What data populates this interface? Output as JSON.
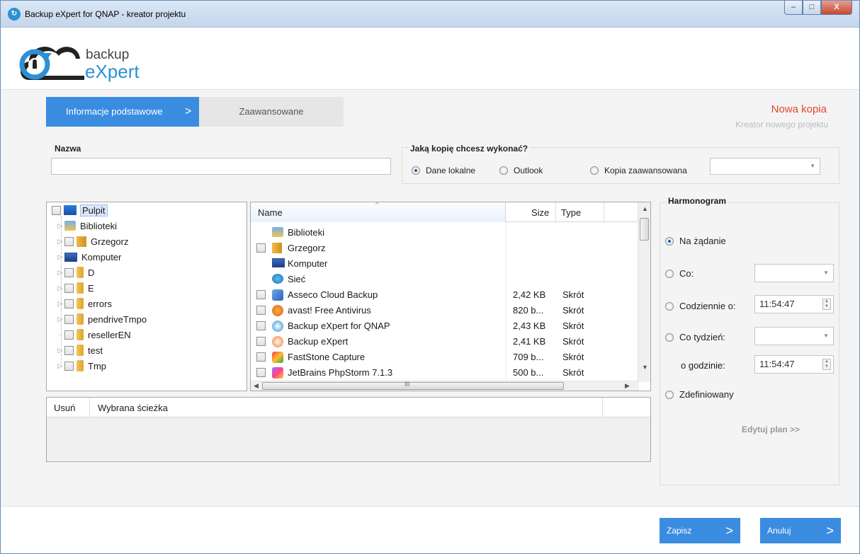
{
  "window": {
    "title": "Backup eXpert for QNAP - kreator projektu",
    "minimize": "‒",
    "maximize": "□",
    "close": "X"
  },
  "logo": {
    "line1": "backup",
    "line2": "eXpert"
  },
  "steps": [
    {
      "label": "Informacje podstawowe",
      "chevron": ">"
    },
    {
      "label": "Zaawansowane"
    }
  ],
  "header": {
    "title": "Nowa kopia",
    "subtitle": "Kreator nowego projektu"
  },
  "nazwa": {
    "label": "Nazwa",
    "value": ""
  },
  "copy_type": {
    "label": "Jaką kopię chcesz wykonać?",
    "options": [
      "Dane lokalne",
      "Outlook",
      "Kopia zaawansowana"
    ],
    "selected": "Dane lokalne",
    "advanced_select_value": ""
  },
  "tree": [
    {
      "label": "Pulpit"
    },
    {
      "label": "Biblioteki"
    },
    {
      "label": "Grzegorz"
    },
    {
      "label": "Komputer"
    },
    {
      "label": "D"
    },
    {
      "label": "E"
    },
    {
      "label": "errors"
    },
    {
      "label": "pendriveTmpo"
    },
    {
      "label": "resellerEN"
    },
    {
      "label": "test"
    },
    {
      "label": "Tmp"
    }
  ],
  "file_list": {
    "columns": {
      "name": "Name",
      "size": "Size",
      "type": "Type"
    },
    "sort_indicator": "^",
    "rows": [
      {
        "name": "Biblioteki",
        "size": "",
        "type": ""
      },
      {
        "name": "Grzegorz",
        "size": "",
        "type": ""
      },
      {
        "name": "Komputer",
        "size": "",
        "type": ""
      },
      {
        "name": "Sieć",
        "size": "",
        "type": ""
      },
      {
        "name": "Asseco Cloud Backup",
        "size": "2,42 KB",
        "type": "Skrót"
      },
      {
        "name": "avast! Free Antivirus",
        "size": "820 b...",
        "type": "Skrót"
      },
      {
        "name": "Backup eXpert for QNAP",
        "size": "2,43 KB",
        "type": "Skrót"
      },
      {
        "name": "Backup eXpert",
        "size": "2,41 KB",
        "type": "Skrót"
      },
      {
        "name": "FastStone Capture",
        "size": "709 b...",
        "type": "Skrót"
      },
      {
        "name": "JetBrains PhpStorm 7.1.3",
        "size": "500 b...",
        "type": "Skrót"
      }
    ],
    "hscroll_grip": "III"
  },
  "paths": {
    "col_remove": "Usuń",
    "col_path": "Wybrana ścieżka"
  },
  "schedule": {
    "label": "Harmonogram",
    "options": {
      "on_demand": "Na żądanie",
      "every": "Co:",
      "daily": "Codziennie o:",
      "weekly": "Co tydzień:",
      "at_hour": "o godzinie:",
      "custom": "Zdefiniowany"
    },
    "selected": "Na żądanie",
    "daily_time": "11:54:47",
    "weekly_time": "11:54:47",
    "edit_plan": "Edytuj plan >>"
  },
  "footer": {
    "save": "Zapisz",
    "cancel": "Anuluj",
    "chevron": ">"
  },
  "colors": {
    "accent": "#3a8ce0",
    "title_red": "#e5462c"
  }
}
